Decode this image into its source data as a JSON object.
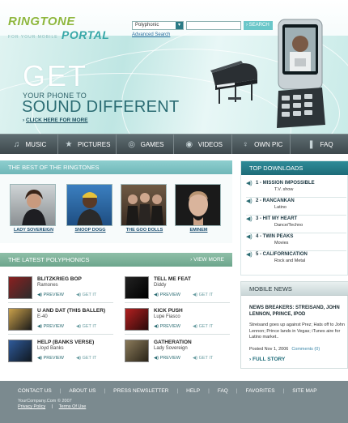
{
  "logo": {
    "part1": "RINGTONE",
    "part2": "PORTAL",
    "tagline": "FOR YOUR MOBILE"
  },
  "search": {
    "select_value": "Polyphonic",
    "input_value": "",
    "button_label": "SEARCH",
    "advanced_link": "Advanced Search"
  },
  "hero": {
    "big_word": "GET",
    "line2": "YOUR PHONE TO",
    "line3": "SOUND DIFFERENT",
    "cta": "CLICK HERE FOR MORE"
  },
  "nav": {
    "items": [
      {
        "label": "MUSIC",
        "icon": "music-note-icon"
      },
      {
        "label": "PICTURES",
        "icon": "star-icon"
      },
      {
        "label": "GAMES",
        "icon": "gamepad-icon"
      },
      {
        "label": "VIDEOS",
        "icon": "film-icon"
      },
      {
        "label": "OWN PIC",
        "icon": "pin-icon"
      },
      {
        "label": "FAQ",
        "icon": "question-icon"
      }
    ]
  },
  "best_ringtones": {
    "heading": "THE BEST OF THE RINGTONES",
    "items": [
      {
        "name": "LADY SOVEREIGN"
      },
      {
        "name": "SNOOP DOGG"
      },
      {
        "name": "THE GOO DOLLS"
      },
      {
        "name": "EMINEM"
      }
    ]
  },
  "polyphonics": {
    "heading": "THE LATEST POLYPHONICS",
    "view_more": "VIEW MORE",
    "preview_label": "PREVIEW",
    "getit_label": "GET IT",
    "items": [
      {
        "title": "BLITZKRIEG BOP",
        "artist": "Ramones"
      },
      {
        "title": "TELL ME FEAT",
        "artist": "Diddy"
      },
      {
        "title": "U AND DAT (THIS BALLER)",
        "artist": "E-40"
      },
      {
        "title": "KICK PUSH",
        "artist": "Lupe Fiasco"
      },
      {
        "title": "HELP (BANKS VERSE)",
        "artist": "Lloyd Banks"
      },
      {
        "title": "GATHERATION",
        "artist": "Lady Sovereign"
      }
    ]
  },
  "top_downloads": {
    "heading": "TOP DOWNLOADS",
    "items": [
      {
        "title": "1 - MISSION IMPOSSIBLE",
        "genre": "T.V. show"
      },
      {
        "title": "2 - RANCANKAN",
        "genre": "Latino"
      },
      {
        "title": "3 - HIT MY HEART",
        "genre": "Dance/Techno"
      },
      {
        "title": "4 - TWIN PEAKS",
        "genre": "Movies"
      },
      {
        "title": "5 - CALIFORNICATION",
        "genre": "Rock and Metal"
      }
    ]
  },
  "news": {
    "heading": "MOBILE NEWS",
    "title": "NEWS BREAKERS: STREISAND, JOHN LENNON, PRINCE, IPOD",
    "body": "Streisand goes up against Prez; Hats off to John Lennon; Prince lands in Vegas; iTunes aire for Latino market..",
    "date": "Posted Nov 1, 2006",
    "comments": "Comments (0)",
    "full_story": "FULL STORY"
  },
  "footer": {
    "links": [
      "CONTACT US",
      "ABOUT US",
      "PRESS NEWSLETTER",
      "HELP",
      "FAQ",
      "FAVORITES",
      "SITE MAP"
    ],
    "copyright": "YourCompany.Com © 2007",
    "privacy": "Privacy Policy",
    "terms": "Terms Of Use"
  },
  "colors": {
    "accent_teal": "#6fb7b8",
    "nav_dark": "#3d484c",
    "downloads_head": "#1d6b78",
    "footer": "#7b8a8f",
    "logo_green": "#8fb73e"
  }
}
